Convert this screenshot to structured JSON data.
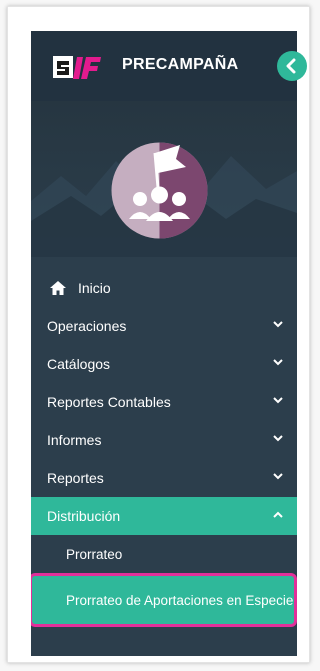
{
  "header": {
    "app_title": "PRECAMPAÑA",
    "logo_text": "SIF"
  },
  "menu": {
    "items": [
      {
        "label": "Inicio",
        "icon": "home-icon"
      },
      {
        "label": "Operaciones",
        "icon": "chevron-down-icon"
      },
      {
        "label": "Catálogos",
        "icon": "chevron-down-icon"
      },
      {
        "label": "Reportes Contables",
        "icon": "chevron-down-icon"
      },
      {
        "label": "Informes",
        "icon": "chevron-down-icon"
      },
      {
        "label": "Reportes",
        "icon": "chevron-down-icon"
      },
      {
        "label": "Distribución",
        "icon": "chevron-up-icon",
        "state": "expanded"
      }
    ],
    "distribucion_submenu": [
      {
        "label": "Prorrateo"
      },
      {
        "label": "Prorrateo de Aportaciones en Especie",
        "state": "highlighted"
      }
    ]
  },
  "colors": {
    "sidebar_bg": "#2c3e4c",
    "header_bg": "#223240",
    "accent": "#2fb89a",
    "highlight_border": "#e32f9a",
    "logo_magenta": "#e31b8e"
  }
}
